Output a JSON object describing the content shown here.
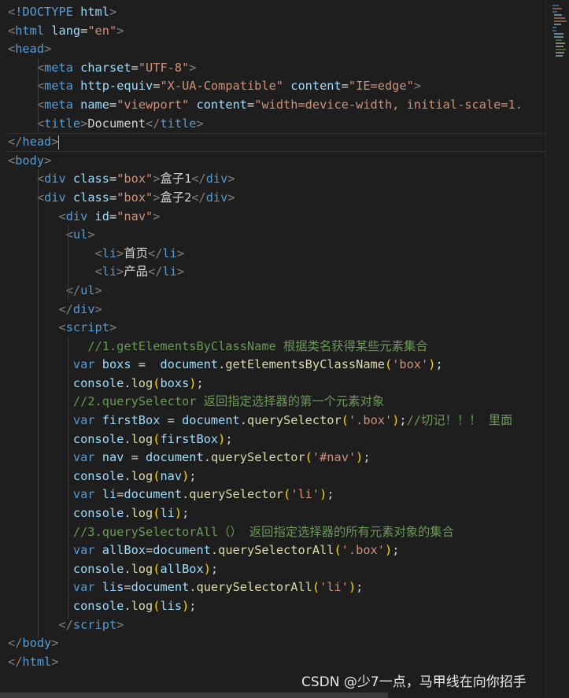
{
  "editor": {
    "lines": [
      [
        [
          "bracket",
          "<"
        ],
        [
          "tag",
          "!DOCTYPE"
        ],
        [
          "text",
          " "
        ],
        [
          "attr",
          "html"
        ],
        [
          "bracket",
          ">"
        ]
      ],
      [
        [
          "bracket",
          "<"
        ],
        [
          "tag",
          "html"
        ],
        [
          "text",
          " "
        ],
        [
          "attr",
          "lang"
        ],
        [
          "text",
          "="
        ],
        [
          "str",
          "\"en\""
        ],
        [
          "bracket",
          ">"
        ]
      ],
      [
        [
          "bracket",
          "<"
        ],
        [
          "tag",
          "head"
        ],
        [
          "bracket",
          ">"
        ]
      ],
      [
        [
          "text",
          "    "
        ],
        [
          "bracket",
          "<"
        ],
        [
          "tag",
          "meta"
        ],
        [
          "text",
          " "
        ],
        [
          "attr",
          "charset"
        ],
        [
          "text",
          "="
        ],
        [
          "str",
          "\"UTF-8\""
        ],
        [
          "bracket",
          ">"
        ]
      ],
      [
        [
          "text",
          "    "
        ],
        [
          "bracket",
          "<"
        ],
        [
          "tag",
          "meta"
        ],
        [
          "text",
          " "
        ],
        [
          "attr",
          "http-equiv"
        ],
        [
          "text",
          "="
        ],
        [
          "str",
          "\"X-UA-Compatible\""
        ],
        [
          "text",
          " "
        ],
        [
          "attr",
          "content"
        ],
        [
          "text",
          "="
        ],
        [
          "str",
          "\"IE=edge\""
        ],
        [
          "bracket",
          ">"
        ]
      ],
      [
        [
          "text",
          "    "
        ],
        [
          "bracket",
          "<"
        ],
        [
          "tag",
          "meta"
        ],
        [
          "text",
          " "
        ],
        [
          "attr",
          "name"
        ],
        [
          "text",
          "="
        ],
        [
          "str",
          "\"viewport\""
        ],
        [
          "text",
          " "
        ],
        [
          "attr",
          "content"
        ],
        [
          "text",
          "="
        ],
        [
          "str",
          "\"width=device-width, initial-scale=1."
        ]
      ],
      [
        [
          "text",
          "    "
        ],
        [
          "bracket",
          "<"
        ],
        [
          "tag",
          "title"
        ],
        [
          "bracket",
          ">"
        ],
        [
          "text",
          "Document"
        ],
        [
          "bracket",
          "</"
        ],
        [
          "tag",
          "title"
        ],
        [
          "bracket",
          ">"
        ]
      ],
      [
        [
          "bracket",
          "</"
        ],
        [
          "tag",
          "head"
        ],
        [
          "bracket",
          ">"
        ]
      ],
      [
        [
          "bracket",
          "<"
        ],
        [
          "tag",
          "body"
        ],
        [
          "bracket",
          ">"
        ]
      ],
      [
        [
          "text",
          "    "
        ],
        [
          "bracket",
          "<"
        ],
        [
          "tag",
          "div"
        ],
        [
          "text",
          " "
        ],
        [
          "attr",
          "class"
        ],
        [
          "text",
          "="
        ],
        [
          "str",
          "\"box\""
        ],
        [
          "bracket",
          ">"
        ],
        [
          "text",
          "盒子1"
        ],
        [
          "bracket",
          "</"
        ],
        [
          "tag",
          "div"
        ],
        [
          "bracket",
          ">"
        ]
      ],
      [
        [
          "text",
          "    "
        ],
        [
          "bracket",
          "<"
        ],
        [
          "tag",
          "div"
        ],
        [
          "text",
          " "
        ],
        [
          "attr",
          "class"
        ],
        [
          "text",
          "="
        ],
        [
          "str",
          "\"box\""
        ],
        [
          "bracket",
          ">"
        ],
        [
          "text",
          "盒子2"
        ],
        [
          "bracket",
          "</"
        ],
        [
          "tag",
          "div"
        ],
        [
          "bracket",
          ">"
        ]
      ],
      [
        [
          "text",
          "       "
        ],
        [
          "bracket",
          "<"
        ],
        [
          "tag",
          "div"
        ],
        [
          "text",
          " "
        ],
        [
          "attr",
          "id"
        ],
        [
          "text",
          "="
        ],
        [
          "str",
          "\"nav\""
        ],
        [
          "bracket",
          ">"
        ]
      ],
      [
        [
          "text",
          "        "
        ],
        [
          "bracket",
          "<"
        ],
        [
          "tag",
          "ul"
        ],
        [
          "bracket",
          ">"
        ]
      ],
      [
        [
          "text",
          "            "
        ],
        [
          "bracket",
          "<"
        ],
        [
          "tag",
          "li"
        ],
        [
          "bracket",
          ">"
        ],
        [
          "text",
          "首页"
        ],
        [
          "bracket",
          "</"
        ],
        [
          "tag",
          "li"
        ],
        [
          "bracket",
          ">"
        ]
      ],
      [
        [
          "text",
          "            "
        ],
        [
          "bracket",
          "<"
        ],
        [
          "tag",
          "li"
        ],
        [
          "bracket",
          ">"
        ],
        [
          "text",
          "产品"
        ],
        [
          "bracket",
          "</"
        ],
        [
          "tag",
          "li"
        ],
        [
          "bracket",
          ">"
        ]
      ],
      [
        [
          "text",
          "        "
        ],
        [
          "bracket",
          "</"
        ],
        [
          "tag",
          "ul"
        ],
        [
          "bracket",
          ">"
        ]
      ],
      [
        [
          "text",
          "       "
        ],
        [
          "bracket",
          "</"
        ],
        [
          "tag",
          "div"
        ],
        [
          "bracket",
          ">"
        ]
      ],
      [
        [
          "text",
          "       "
        ],
        [
          "bracket",
          "<"
        ],
        [
          "tag",
          "script"
        ],
        [
          "bracket",
          ">"
        ]
      ],
      [
        [
          "text",
          "           "
        ],
        [
          "com",
          "//1.getElementsByClassName 根据类名获得某些元素集合"
        ]
      ],
      [
        [
          "text",
          "         "
        ],
        [
          "kw",
          "var"
        ],
        [
          "text",
          " "
        ],
        [
          "var",
          "boxs"
        ],
        [
          "text",
          " =  "
        ],
        [
          "var",
          "document"
        ],
        [
          "punc",
          "."
        ],
        [
          "fn",
          "getElementsByClassName"
        ],
        [
          "paren",
          "("
        ],
        [
          "str",
          "'box'"
        ],
        [
          "paren",
          ")"
        ],
        [
          "punc",
          ";"
        ]
      ],
      [
        [
          "text",
          "         "
        ],
        [
          "var",
          "console"
        ],
        [
          "punc",
          "."
        ],
        [
          "fn",
          "log"
        ],
        [
          "paren",
          "("
        ],
        [
          "var",
          "boxs"
        ],
        [
          "paren",
          ")"
        ],
        [
          "punc",
          ";"
        ]
      ],
      [
        [
          "text",
          "         "
        ],
        [
          "com",
          "//2.querySelector 返回指定选择器的第一个元素对象"
        ]
      ],
      [
        [
          "text",
          "         "
        ],
        [
          "kw",
          "var"
        ],
        [
          "text",
          " "
        ],
        [
          "var",
          "firstBox"
        ],
        [
          "text",
          " = "
        ],
        [
          "var",
          "document"
        ],
        [
          "punc",
          "."
        ],
        [
          "fn",
          "querySelector"
        ],
        [
          "paren",
          "("
        ],
        [
          "str",
          "'.box'"
        ],
        [
          "paren",
          ")"
        ],
        [
          "punc",
          ";"
        ],
        [
          "com",
          "//切记！！！ 里面"
        ]
      ],
      [
        [
          "text",
          "         "
        ],
        [
          "var",
          "console"
        ],
        [
          "punc",
          "."
        ],
        [
          "fn",
          "log"
        ],
        [
          "paren",
          "("
        ],
        [
          "var",
          "firstBox"
        ],
        [
          "paren",
          ")"
        ],
        [
          "punc",
          ";"
        ]
      ],
      [
        [
          "text",
          "         "
        ],
        [
          "kw",
          "var"
        ],
        [
          "text",
          " "
        ],
        [
          "var",
          "nav"
        ],
        [
          "text",
          " = "
        ],
        [
          "var",
          "document"
        ],
        [
          "punc",
          "."
        ],
        [
          "fn",
          "querySelector"
        ],
        [
          "paren",
          "("
        ],
        [
          "str",
          "'#nav'"
        ],
        [
          "paren",
          ")"
        ],
        [
          "punc",
          ";"
        ]
      ],
      [
        [
          "text",
          "         "
        ],
        [
          "var",
          "console"
        ],
        [
          "punc",
          "."
        ],
        [
          "fn",
          "log"
        ],
        [
          "paren",
          "("
        ],
        [
          "var",
          "nav"
        ],
        [
          "paren",
          ")"
        ],
        [
          "punc",
          ";"
        ]
      ],
      [
        [
          "text",
          "         "
        ],
        [
          "kw",
          "var"
        ],
        [
          "text",
          " "
        ],
        [
          "var",
          "li"
        ],
        [
          "text",
          "="
        ],
        [
          "var",
          "document"
        ],
        [
          "punc",
          "."
        ],
        [
          "fn",
          "querySelector"
        ],
        [
          "paren",
          "("
        ],
        [
          "str",
          "'li'"
        ],
        [
          "paren",
          ")"
        ],
        [
          "punc",
          ";"
        ]
      ],
      [
        [
          "text",
          "         "
        ],
        [
          "var",
          "console"
        ],
        [
          "punc",
          "."
        ],
        [
          "fn",
          "log"
        ],
        [
          "paren",
          "("
        ],
        [
          "var",
          "li"
        ],
        [
          "paren",
          ")"
        ],
        [
          "punc",
          ";"
        ]
      ],
      [
        [
          "text",
          "         "
        ],
        [
          "com",
          "//3.querySelectorAll（） 返回指定选择器的所有元素对象的集合"
        ]
      ],
      [
        [
          "text",
          "         "
        ],
        [
          "kw",
          "var"
        ],
        [
          "text",
          " "
        ],
        [
          "var",
          "allBox"
        ],
        [
          "text",
          "="
        ],
        [
          "var",
          "document"
        ],
        [
          "punc",
          "."
        ],
        [
          "fn",
          "querySelectorAll"
        ],
        [
          "paren",
          "("
        ],
        [
          "str",
          "'.box'"
        ],
        [
          "paren",
          ")"
        ],
        [
          "punc",
          ";"
        ]
      ],
      [
        [
          "text",
          "         "
        ],
        [
          "var",
          "console"
        ],
        [
          "punc",
          "."
        ],
        [
          "fn",
          "log"
        ],
        [
          "paren",
          "("
        ],
        [
          "var",
          "allBox"
        ],
        [
          "paren",
          ")"
        ],
        [
          "punc",
          ";"
        ]
      ],
      [
        [
          "text",
          "         "
        ],
        [
          "kw",
          "var"
        ],
        [
          "text",
          " "
        ],
        [
          "var",
          "lis"
        ],
        [
          "text",
          "="
        ],
        [
          "var",
          "document"
        ],
        [
          "punc",
          "."
        ],
        [
          "fn",
          "querySelectorAll"
        ],
        [
          "paren",
          "("
        ],
        [
          "str",
          "'li'"
        ],
        [
          "paren",
          ")"
        ],
        [
          "punc",
          ";"
        ]
      ],
      [
        [
          "text",
          "         "
        ],
        [
          "var",
          "console"
        ],
        [
          "punc",
          "."
        ],
        [
          "fn",
          "log"
        ],
        [
          "paren",
          "("
        ],
        [
          "var",
          "lis"
        ],
        [
          "paren",
          ")"
        ],
        [
          "punc",
          ";"
        ]
      ],
      [
        [
          "text",
          "       "
        ],
        [
          "bracket",
          "</"
        ],
        [
          "tag",
          "script"
        ],
        [
          "bracket",
          ">"
        ]
      ],
      [
        [
          "bracket",
          "</"
        ],
        [
          "tag",
          "body"
        ],
        [
          "bracket",
          ">"
        ]
      ],
      [
        [
          "bracket",
          "</"
        ],
        [
          "tag",
          "html"
        ],
        [
          "bracket",
          ">"
        ]
      ]
    ],
    "cursor_line_index": 7
  },
  "watermark": {
    "text": "CSDN @少7一点，马甲线在向你招手"
  },
  "colors": {
    "background": "#1e1e1e",
    "tag": "#569cd6",
    "attribute": "#9cdcfe",
    "string": "#ce9178",
    "comment": "#6a9955",
    "function": "#dcdcaa",
    "keyword": "#569cd6",
    "bracket": "#808080",
    "paren": "#ffd700"
  }
}
